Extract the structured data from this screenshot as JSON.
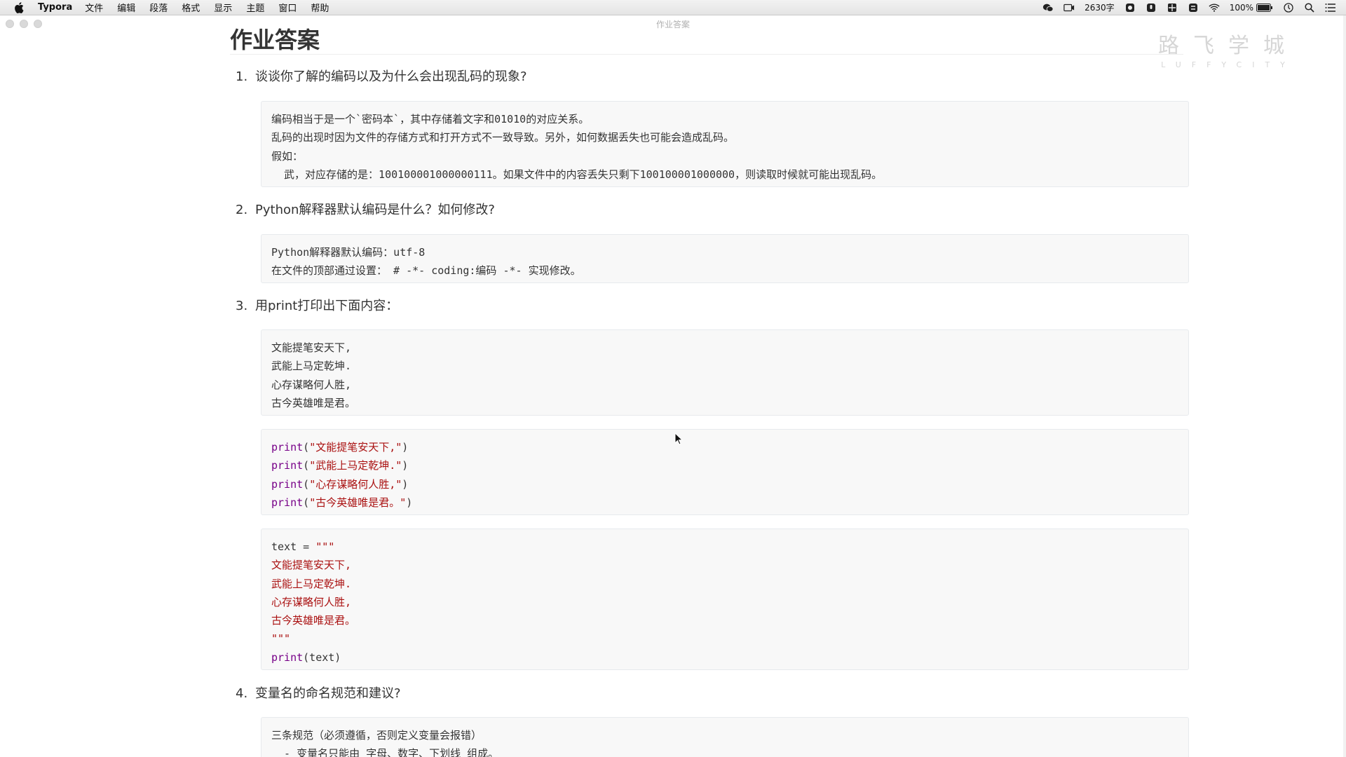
{
  "menubar": {
    "app_name": "Typora",
    "items": [
      "文件",
      "编辑",
      "段落",
      "格式",
      "显示",
      "主题",
      "窗口",
      "帮助"
    ],
    "word_count": "2630字",
    "battery": "100%"
  },
  "window": {
    "title": "作业答案"
  },
  "watermark": {
    "cn": "路飞学城",
    "en": "LUFFYCITY"
  },
  "doc": {
    "title": "作业答案",
    "q1": {
      "num": "1.",
      "text": "谈谈你了解的编码以及为什么会出现乱码的现象?",
      "code_lines": [
        "编码相当于是一个`密码本`，其中存储着文字和01010的对应关系。",
        "乱码的出现时因为文件的存储方式和打开方式不一致导致。另外，如何数据丢失也可能会造成乱码。",
        "假如：",
        "  武，对应存储的是：100100001000000111。如果文件中的内容丢失只剩下100100001000000，则读取时候就可能出现乱码。"
      ]
    },
    "q2": {
      "num": "2.",
      "text": "Python解释器默认编码是什么？如何修改?",
      "code_lines": [
        "Python解释器默认编码：utf-8",
        "在文件的顶部通过设置： # -*- coding:编码 -*- 实现修改。"
      ]
    },
    "q3": {
      "num": "3.",
      "text": "用print打印出下面内容：",
      "poem": [
        "文能提笔安天下,",
        "武能上马定乾坤.",
        "心存谋略何人胜,",
        "古今英雄唯是君。"
      ],
      "print_kw": "print",
      "print_args": [
        "\"文能提笔安天下,\"",
        "\"武能上马定乾坤.\"",
        "\"心存谋略何人胜,\"",
        "\"古今英雄唯是君。\""
      ],
      "text_assign": "text = ",
      "triple_quote": "\"\"\"",
      "final_call": "(text)"
    },
    "q4": {
      "num": "4.",
      "text": "变量名的命名规范和建议?",
      "code_lines": [
        "三条规范（必须遵循，否则定义变量会报错）",
        "  - 变量名只能由 字母、数字、下划线 组成。"
      ]
    }
  }
}
